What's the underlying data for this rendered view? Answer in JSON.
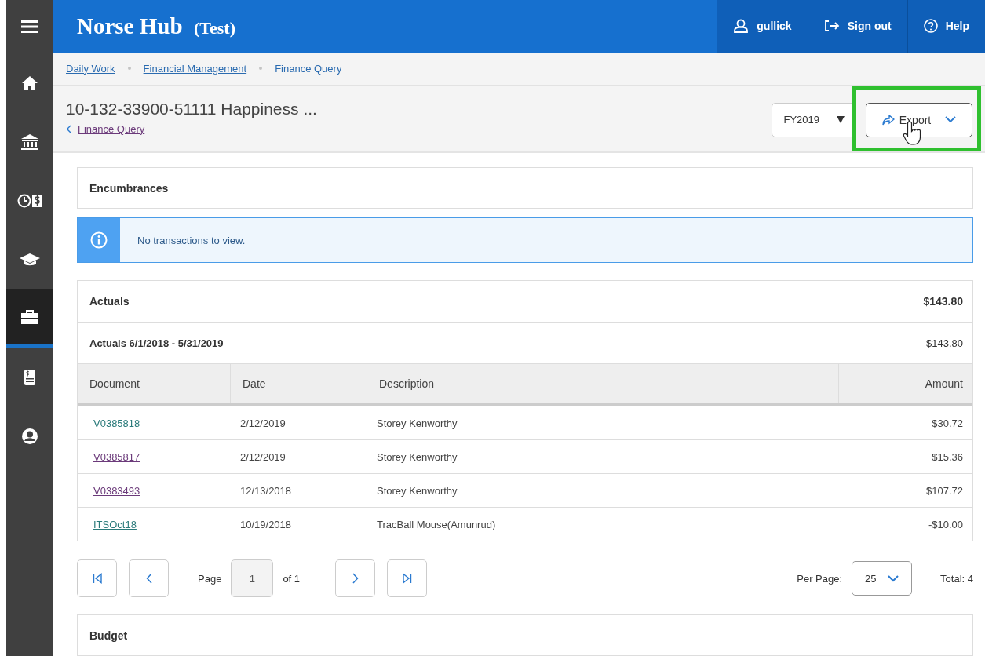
{
  "sidebar": {
    "items": [
      {
        "kind": "menu",
        "selected": false
      },
      {
        "kind": "home",
        "selected": false
      },
      {
        "kind": "bank",
        "selected": false
      },
      {
        "kind": "clock-money",
        "selected": false
      },
      {
        "kind": "graduation",
        "selected": false
      },
      {
        "kind": "briefcase",
        "selected": true
      },
      {
        "kind": "receipt",
        "selected": false
      },
      {
        "kind": "user",
        "selected": false
      }
    ]
  },
  "header": {
    "brand": "Norse Hub",
    "env": "(Test)",
    "actions": [
      {
        "kind": "user",
        "label": "gullick"
      },
      {
        "kind": "signout",
        "label": "Sign out"
      },
      {
        "kind": "help",
        "label": "Help"
      }
    ]
  },
  "breadcrumb": [
    {
      "label": "Daily Work",
      "link": true
    },
    {
      "label": "Financial Management",
      "link": true
    },
    {
      "label": "Finance Query",
      "link": false
    }
  ],
  "page": {
    "title": "10-132-33900-51111 Happiness ...",
    "back_link": {
      "label": "Finance Query",
      "visited": true
    },
    "fiscal_year": "FY2019",
    "export_button": "Export",
    "highlighted": true
  },
  "encumbrances": {
    "title": "Encumbrances",
    "message": "No transactions to view."
  },
  "actuals": {
    "title": "Actuals",
    "total": "$143.80",
    "period": "Actuals 6/1/2018 - 5/31/2019",
    "period_total": "$143.80",
    "columns": [
      "Document",
      "Date",
      "Description",
      "Amount"
    ],
    "rows": [
      {
        "document": "V0385818",
        "visited": false,
        "date": "2/12/2019",
        "description": "Storey Kenworthy",
        "amount": "$30.72"
      },
      {
        "document": "V0385817",
        "visited": true,
        "date": "2/12/2019",
        "description": "Storey Kenworthy",
        "amount": "$15.36"
      },
      {
        "document": "V0383493",
        "visited": true,
        "date": "12/13/2018",
        "description": "Storey Kenworthy",
        "amount": "$107.72"
      },
      {
        "document": "ITSOct18",
        "visited": false,
        "date": "10/19/2018",
        "description": "TracBall Mouse(Amunrud)",
        "amount": "-$10.00"
      }
    ]
  },
  "pager": {
    "page_label": "Page",
    "page": "1",
    "of": "of 1",
    "per_page_label": "Per Page:",
    "per_page": "25",
    "total": "Total: 4"
  },
  "budget": {
    "title": "Budget"
  }
}
